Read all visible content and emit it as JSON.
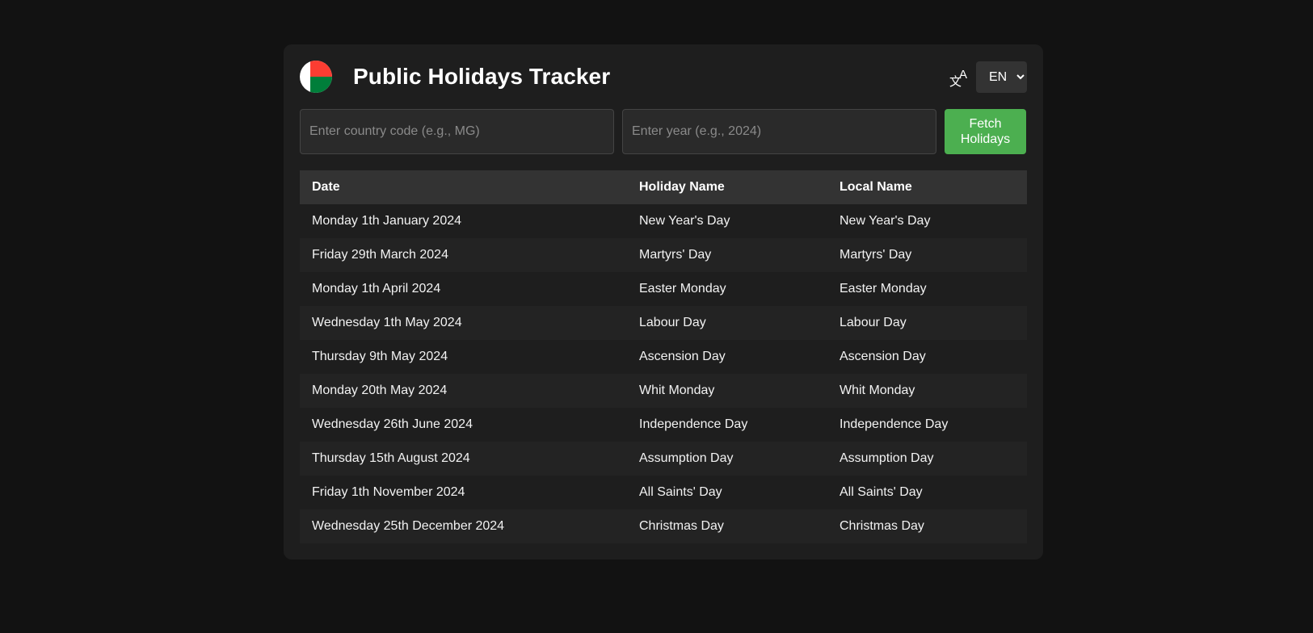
{
  "header": {
    "title": "Public Holidays Tracker",
    "flag_icon": "madagascar-flag-icon",
    "language_selected": "EN",
    "language_options": [
      "EN"
    ]
  },
  "controls": {
    "country_placeholder": "Enter country code (e.g., MG)",
    "country_value": "",
    "year_placeholder": "Enter year (e.g., 2024)",
    "year_value": "",
    "fetch_label": "Fetch Holidays"
  },
  "table": {
    "headers": [
      "Date",
      "Holiday Name",
      "Local Name"
    ],
    "rows": [
      [
        "Monday 1th January 2024",
        "New Year's Day",
        "New Year's Day"
      ],
      [
        "Friday 29th March 2024",
        "Martyrs' Day",
        "Martyrs' Day"
      ],
      [
        "Monday 1th April 2024",
        "Easter Monday",
        "Easter Monday"
      ],
      [
        "Wednesday 1th May 2024",
        "Labour Day",
        "Labour Day"
      ],
      [
        "Thursday 9th May 2024",
        "Ascension Day",
        "Ascension Day"
      ],
      [
        "Monday 20th May 2024",
        "Whit Monday",
        "Whit Monday"
      ],
      [
        "Wednesday 26th June 2024",
        "Independence Day",
        "Independence Day"
      ],
      [
        "Thursday 15th August 2024",
        "Assumption Day",
        "Assumption Day"
      ],
      [
        "Friday 1th November 2024",
        "All Saints' Day",
        "All Saints' Day"
      ],
      [
        "Wednesday 25th December 2024",
        "Christmas Day",
        "Christmas Day"
      ]
    ]
  },
  "colors": {
    "background": "#121212",
    "card": "#1e1e1e",
    "accent_button": "#4caf50",
    "flag_red": "#fc3d32",
    "flag_green": "#007e3a"
  }
}
